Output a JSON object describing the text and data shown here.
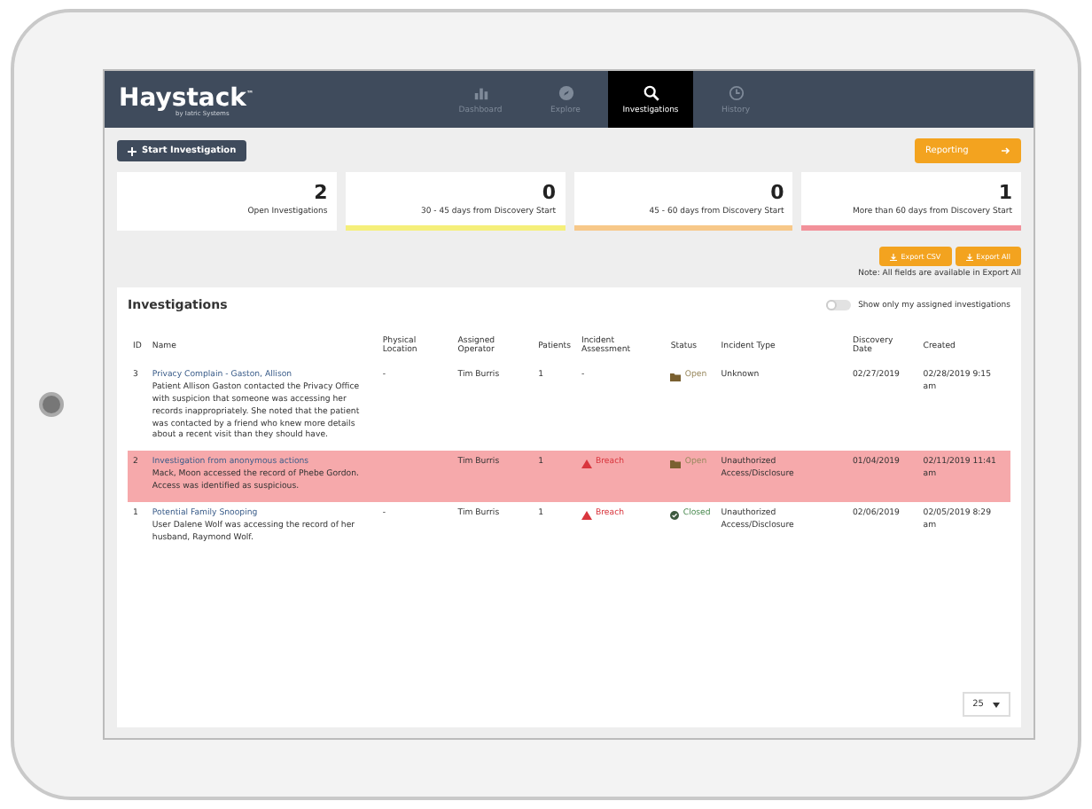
{
  "app": {
    "logo": "Haystack",
    "logo_tm": "™",
    "tagline": "by Iatric Systems"
  },
  "nav": [
    {
      "label": "Dashboard",
      "kind": "dashboard",
      "selected": false
    },
    {
      "label": "Explore",
      "kind": "explore",
      "selected": false
    },
    {
      "label": "Investigations",
      "kind": "investigations",
      "selected": true
    },
    {
      "label": "History",
      "kind": "history",
      "selected": false
    }
  ],
  "toolbar": {
    "start_button": "Start Investigation",
    "reporting_button": "Reporting"
  },
  "stats": [
    {
      "value": "2",
      "label": "Open Investigations"
    },
    {
      "value": "0",
      "label": "30 - 45 days from Discovery Start",
      "color": "#f5ef7a"
    },
    {
      "value": "0",
      "label": "45 - 60 days from Discovery Start",
      "color": "#f7c889"
    },
    {
      "value": "1",
      "label": "More than 60 days from Discovery Start",
      "color": "#f2919a"
    }
  ],
  "exports": {
    "buttons": [
      "Export CSV",
      "Export All"
    ],
    "note": "Note: All fields are available in Export All"
  },
  "investigations": {
    "title": "Investigations",
    "toggle": {
      "label": "Show only my assigned investigations",
      "on": false
    },
    "columns": [
      "ID",
      "Name",
      "Physical Location",
      "Assigned Operator",
      "Patients",
      "Incident Assessment",
      "Status",
      "Incident Type",
      "Discovery Date",
      "Created"
    ],
    "rows": [
      {
        "id": "3",
        "name": "Privacy Complain - Gaston, Allison",
        "description": "Patient Allison Gaston contacted the Privacy Office with suspicion that someone was accessing her records inappropriately. She noted that the patient was contacted by a friend who knew more details about a recent visit than they should have.",
        "location": "-",
        "operator": "Tim Burris",
        "patients": "1",
        "assessment": {
          "kind": "none",
          "label": "-"
        },
        "status": {
          "kind": "open",
          "label": "Open"
        },
        "incident_type": "Unknown",
        "discovery_date": "02/27/2019",
        "created": "02/28/2019 9:15 am",
        "highlighted": false
      },
      {
        "id": "2",
        "name": "Investigation from anonymous actions",
        "description": "Mack, Moon accessed the record of Phebe Gordon. Access was identified as suspicious.",
        "location": "",
        "operator": "Tim Burris",
        "patients": "1",
        "assessment": {
          "kind": "breach",
          "label": "Breach"
        },
        "status": {
          "kind": "open",
          "label": "Open"
        },
        "incident_type": "Unauthorized Access/Disclosure",
        "discovery_date": "01/04/2019",
        "created": "02/11/2019 11:41 am",
        "highlighted": true
      },
      {
        "id": "1",
        "name": "Potential Family Snooping",
        "description": "User Dalene Wolf was accessing the record of her husband, Raymond Wolf.",
        "location": "-",
        "operator": "Tim Burris",
        "patients": "1",
        "assessment": {
          "kind": "breach",
          "label": "Breach"
        },
        "status": {
          "kind": "closed",
          "label": "Closed"
        },
        "incident_type": "Unauthorized Access/Disclosure",
        "discovery_date": "02/06/2019",
        "created": "02/05/2019 8:29 am",
        "highlighted": false
      }
    ],
    "page_size": "25"
  }
}
